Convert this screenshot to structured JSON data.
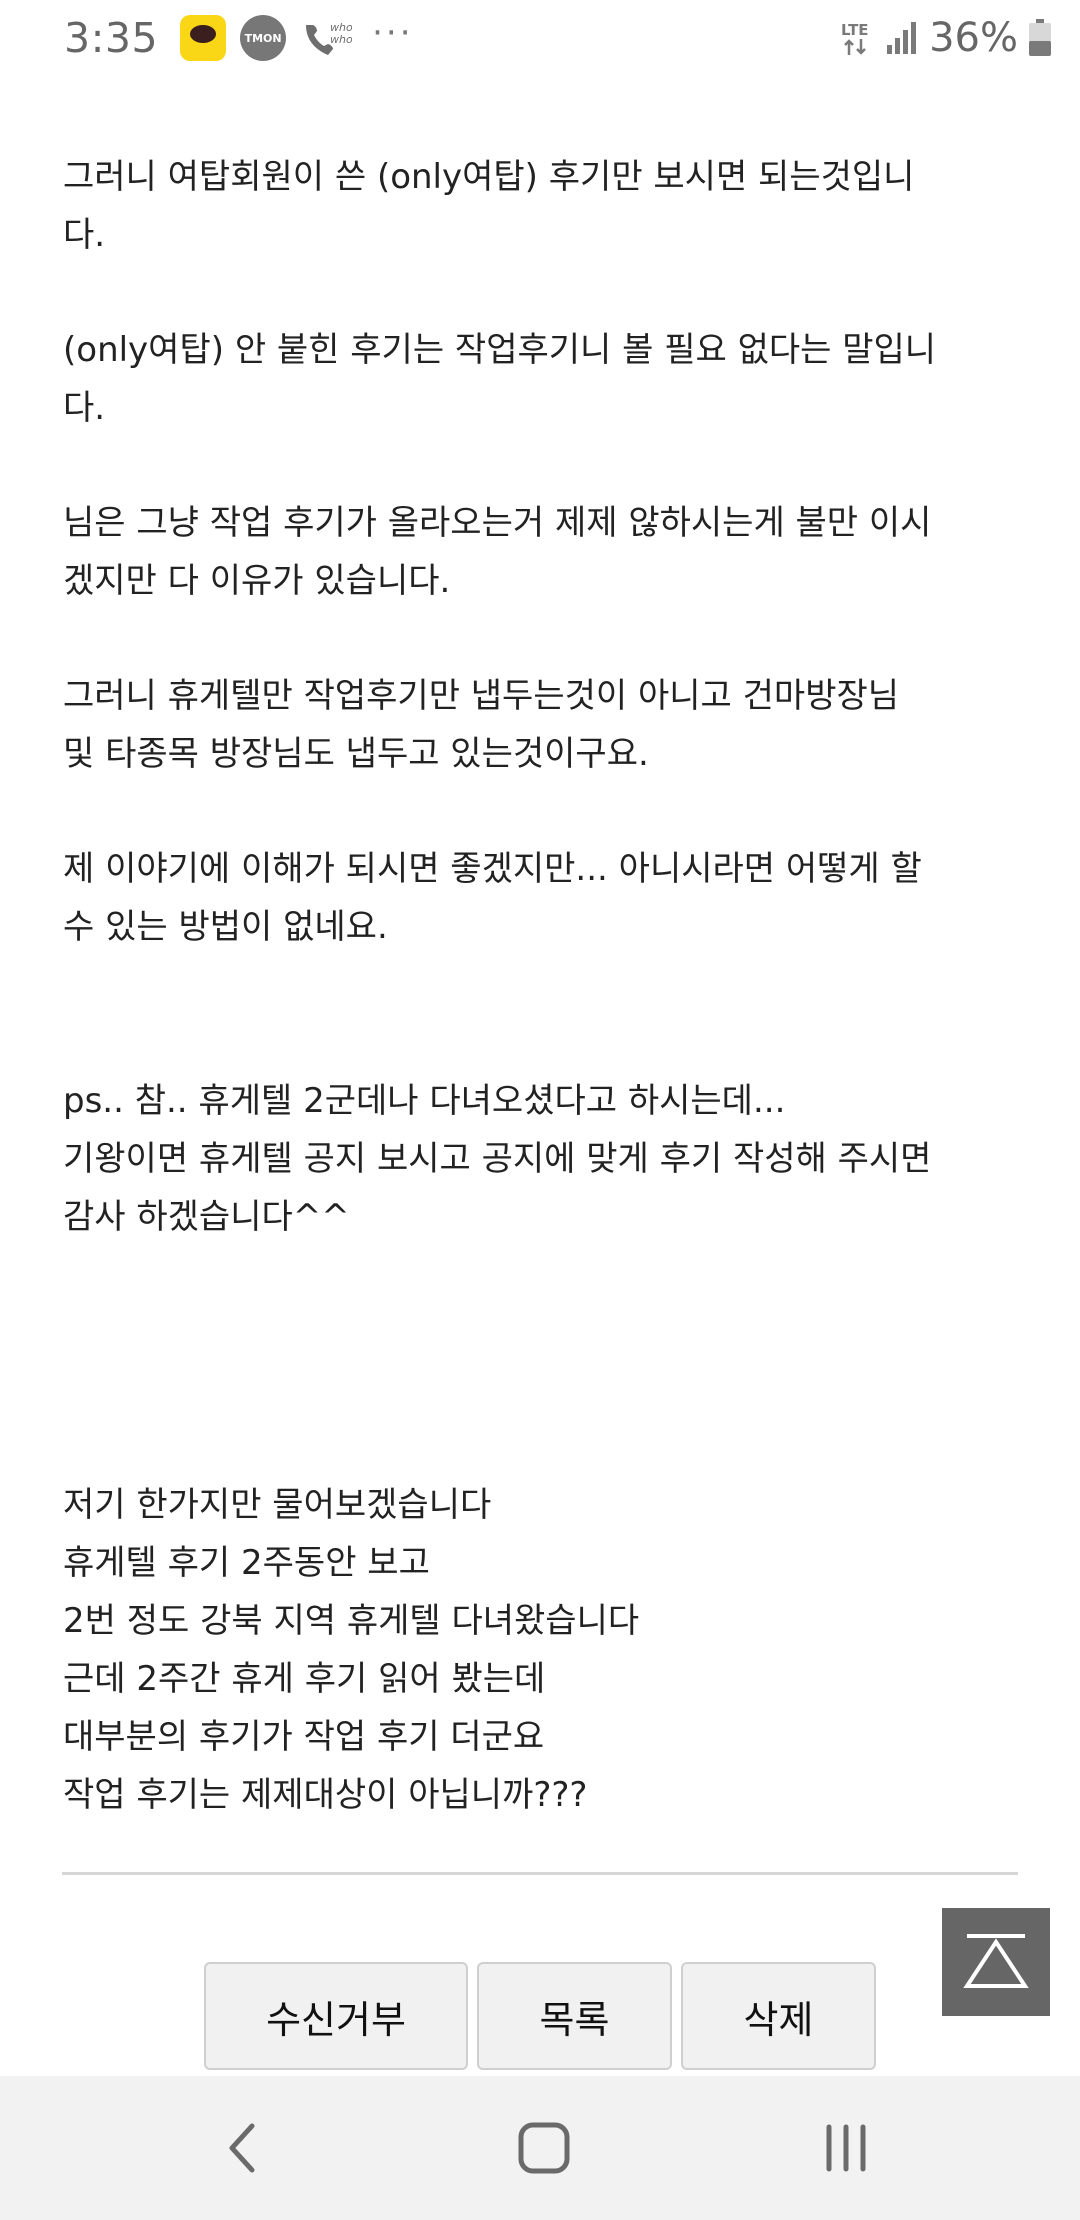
{
  "status_bar": {
    "time": "3:35",
    "tmon_label": "TMON",
    "more_label": "···",
    "network": "LTE",
    "battery": "36%"
  },
  "article": {
    "paragraphs": [
      "그러니 여탑회원이 쓴 (only여탑) 후기만 보시면 되는것입니\n다.",
      "(only여탑) 안 붙힌 후기는 작업후기니 볼 필요 없다는 말입니\n다.",
      "님은 그냥 작업 후기가 올라오는거 제제 않하시는게 불만 이시\n겠지만 다 이유가 있습니다.",
      "그러니 휴게텔만 작업후기만 냅두는것이 아니고 건마방장님\n및 타종목 방장님도 냅두고 있는것이구요.",
      "제 이야기에 이해가 되시면 좋겠지만... 아니시라면 어떻게 할\n수 있는 방법이 없네요.",
      "ps.. 참.. 휴게텔 2군데나 다녀오셨다고 하시는데...\n기왕이면 휴게텔 공지 보시고 공지에 맞게 후기 작성해 주시면\n감사 하겠습니다^^",
      "저기 한가지만 물어보겠습니다\n휴게텔 후기 2주동안 보고\n2번 정도 강북 지역 휴게텔 다녀왔습니다\n근데 2주간 휴게 후기 읽어 봤는데\n대부분의 후기가 작업 후기 더군요\n작업 후기는 제제대상이 아닙니까???"
    ]
  },
  "actions": {
    "block_label": "수신거부",
    "list_label": "목록",
    "delete_label": "삭제"
  }
}
